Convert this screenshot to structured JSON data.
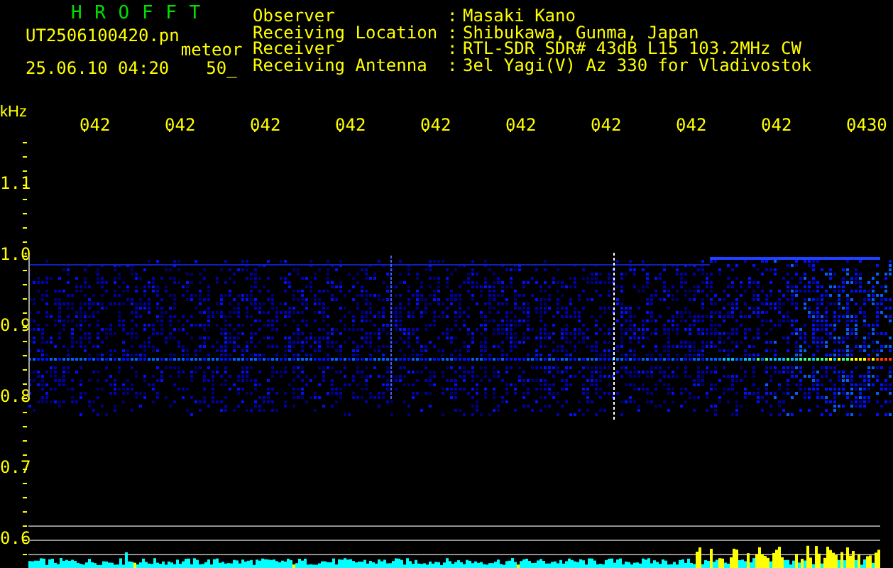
{
  "header": {
    "title": "H R O F F T",
    "filename": "UT2506100420.pn",
    "mode": "meteor",
    "datetime": "25.06.10 04:20",
    "value": "50_"
  },
  "info": [
    {
      "label": "Observer",
      "separator": ":",
      "value": "Masaki Kano"
    },
    {
      "label": "Receiving Location",
      "separator": ":",
      "value": "Shibukawa, Gunma, Japan"
    },
    {
      "label": "Receiver",
      "separator": ":",
      "value": "RTL-SDR SDR# 43dB L15 103.2MHz CW"
    },
    {
      "label": "Receiving Antenna",
      "separator": ":",
      "value": "3el Yagi(V) Az 330 for Vladivostok"
    }
  ],
  "x_axis": {
    "labels": [
      "042",
      "042",
      "042",
      "042",
      "042",
      "042",
      "042",
      "042",
      "042",
      "0430"
    ]
  },
  "y_axis": {
    "unit": "kHz",
    "labels": [
      "1.1",
      "1.0",
      "0.9",
      "0.8",
      "0.7",
      "0.6"
    ]
  }
}
